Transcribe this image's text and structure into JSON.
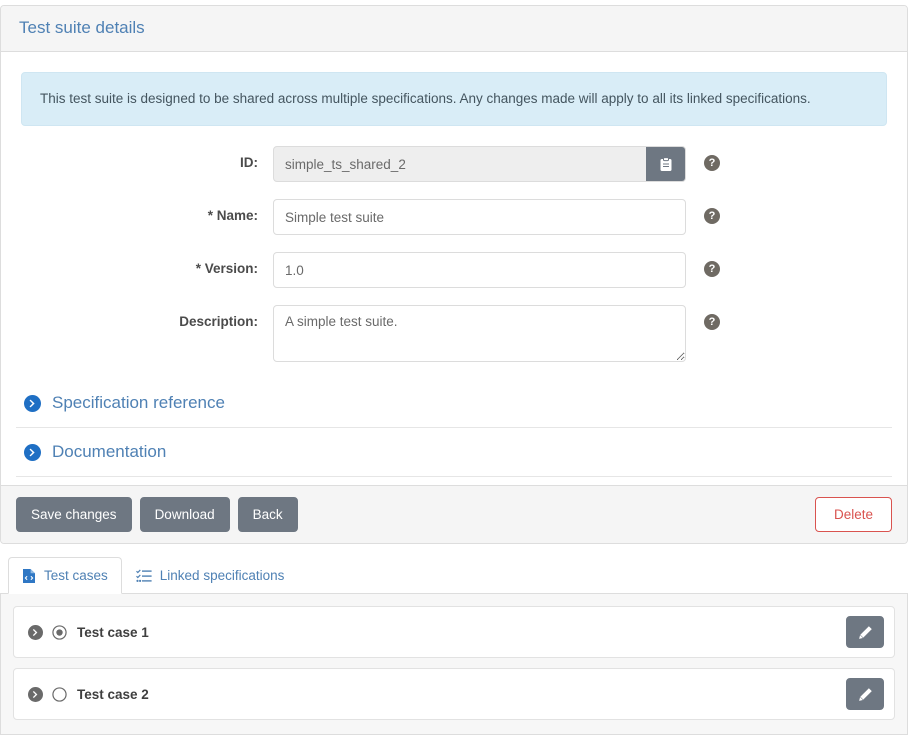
{
  "panel": {
    "title": "Test suite details",
    "alert": "This test suite is designed to be shared across multiple specifications. Any changes made will apply to all its linked specifications."
  },
  "form": {
    "id": {
      "label": "ID:",
      "value": "simple_ts_shared_2",
      "copy_icon": "clipboard-icon",
      "help_icon": "question-mark-icon",
      "help_label": "?"
    },
    "name": {
      "label": "* Name:",
      "value": "Simple test suite",
      "help_label": "?"
    },
    "version": {
      "label": "* Version:",
      "value": "1.0",
      "help_label": "?"
    },
    "description": {
      "label": "Description:",
      "value": "A simple test suite.",
      "help_label": "?"
    }
  },
  "sections": [
    {
      "label": "Specification reference",
      "icon": "chevron-right-circle-icon"
    },
    {
      "label": "Documentation",
      "icon": "chevron-right-circle-icon"
    }
  ],
  "footer": {
    "save_label": "Save changes",
    "download_label": "Download",
    "back_label": "Back",
    "delete_label": "Delete"
  },
  "tabs": [
    {
      "label": "Test cases",
      "icon": "file-code-icon",
      "active": true
    },
    {
      "label": "Linked specifications",
      "icon": "tasks-list-icon",
      "active": false
    }
  ],
  "test_cases": [
    {
      "name": "Test case 1",
      "selected": true,
      "chevron_icon": "chevron-right-circle-icon",
      "radio_icon": "dot-circle-icon",
      "edit_icon": "pencil-icon"
    },
    {
      "name": "Test case 2",
      "selected": false,
      "chevron_icon": "chevron-right-circle-icon",
      "radio_icon": "circle-icon",
      "edit_icon": "pencil-icon"
    }
  ],
  "colors": {
    "accent_blue": "#4f81b4",
    "alert_bg": "#d9edf7",
    "button_gray": "#6e7782",
    "danger_red": "#d9534f"
  }
}
